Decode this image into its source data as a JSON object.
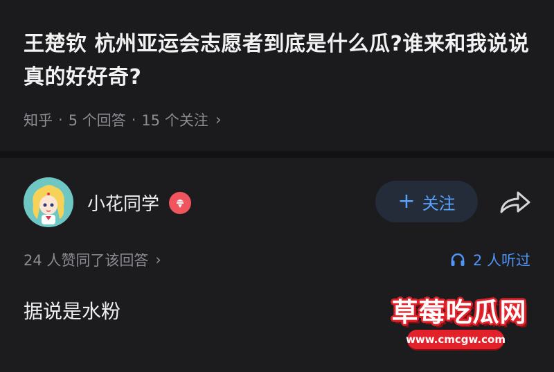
{
  "question": {
    "title": "王楚钦 杭州亚运会志愿者到底是什么瓜?谁来和我说说真的好好奇?",
    "meta": {
      "source": "知乎",
      "answers": "5 个回答",
      "followers": "15 个关注"
    }
  },
  "answer": {
    "author": "小花同学",
    "follow_label": "关注",
    "likes": "24 人赞同了该回答",
    "listens": "2 人听过",
    "content": "据说是水粉"
  },
  "watermark": {
    "text": "草莓吃瓜网",
    "url": "www.cmcgw.com"
  },
  "colors": {
    "background": "#1b1b1e",
    "accent": "#4f95f5",
    "muted": "#8c8c92",
    "badge": "#f0555f"
  },
  "icons": [
    "chevron-right-icon",
    "plus-icon",
    "share-icon",
    "headphones-icon",
    "badge-icon"
  ]
}
